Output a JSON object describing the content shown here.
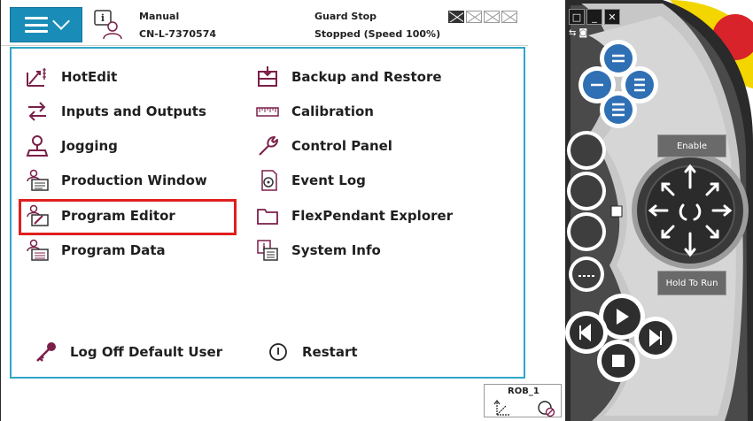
{
  "status": {
    "mode": "Manual",
    "controller": "CN-L-7370574",
    "guard": "Guard Stop",
    "state": "Stopped (Speed 100%)"
  },
  "menu": {
    "left": [
      {
        "label": "HotEdit",
        "icon": "hotedit-icon"
      },
      {
        "label": "Inputs and Outputs",
        "icon": "io-arrows-icon"
      },
      {
        "label": "Jogging",
        "icon": "jogging-joystick-icon"
      },
      {
        "label": "Production Window",
        "icon": "production-window-icon"
      },
      {
        "label": "Program Editor",
        "icon": "program-editor-icon"
      },
      {
        "label": "Program Data",
        "icon": "program-data-icon"
      }
    ],
    "right": [
      {
        "label": "Backup and Restore",
        "icon": "backup-restore-icon"
      },
      {
        "label": "Calibration",
        "icon": "calibration-ruler-icon"
      },
      {
        "label": "Control Panel",
        "icon": "wrench-icon"
      },
      {
        "label": "Event Log",
        "icon": "event-log-icon"
      },
      {
        "label": "FlexPendant Explorer",
        "icon": "folder-icon"
      },
      {
        "label": "System Info",
        "icon": "system-info-icon"
      }
    ],
    "log_off": "Log Off Default User",
    "restart": "Restart"
  },
  "robot": {
    "label": "ROB_1"
  },
  "pendant": {
    "enable_label": "Enable",
    "hold_to_run_label": "Hold To Run"
  },
  "colors": {
    "accent": "#1a8cb8",
    "panel_border": "#2fa6c8",
    "highlight": "#e01e1e",
    "icon": "#7b1f4a",
    "pendant_blue": "#2f6fb4",
    "pendant_yellow": "#f3d600",
    "pendant_red": "#d9232a"
  }
}
